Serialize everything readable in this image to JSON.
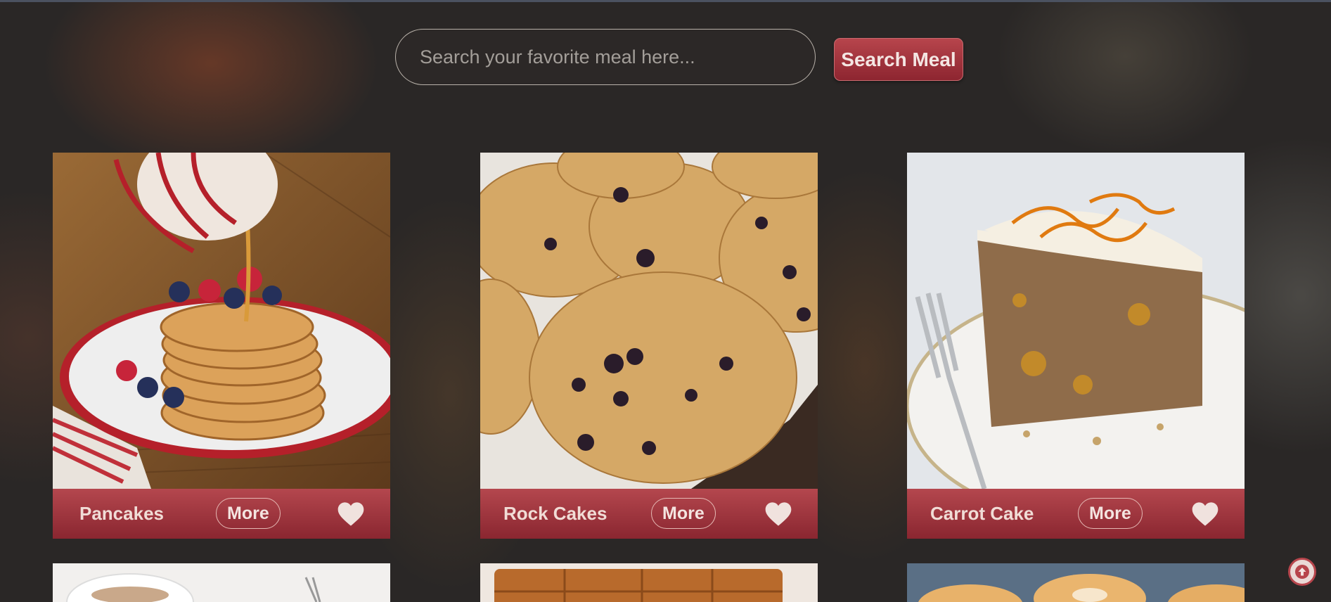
{
  "search": {
    "placeholder": "Search your favorite meal here...",
    "value": "",
    "button_label": "Search Meal"
  },
  "meals": [
    {
      "name": "Pancakes",
      "more_label": "More"
    },
    {
      "name": "Rock Cakes",
      "more_label": "More"
    },
    {
      "name": "Carrot Cake",
      "more_label": "More"
    }
  ],
  "colors": {
    "accent": "#a63a42",
    "accent_dark": "#8a2630",
    "background": "#2a2726",
    "heart": "#f0e2de"
  },
  "icons": {
    "favorite": "heart-icon",
    "scroll_top": "arrow-up-circle-icon"
  }
}
